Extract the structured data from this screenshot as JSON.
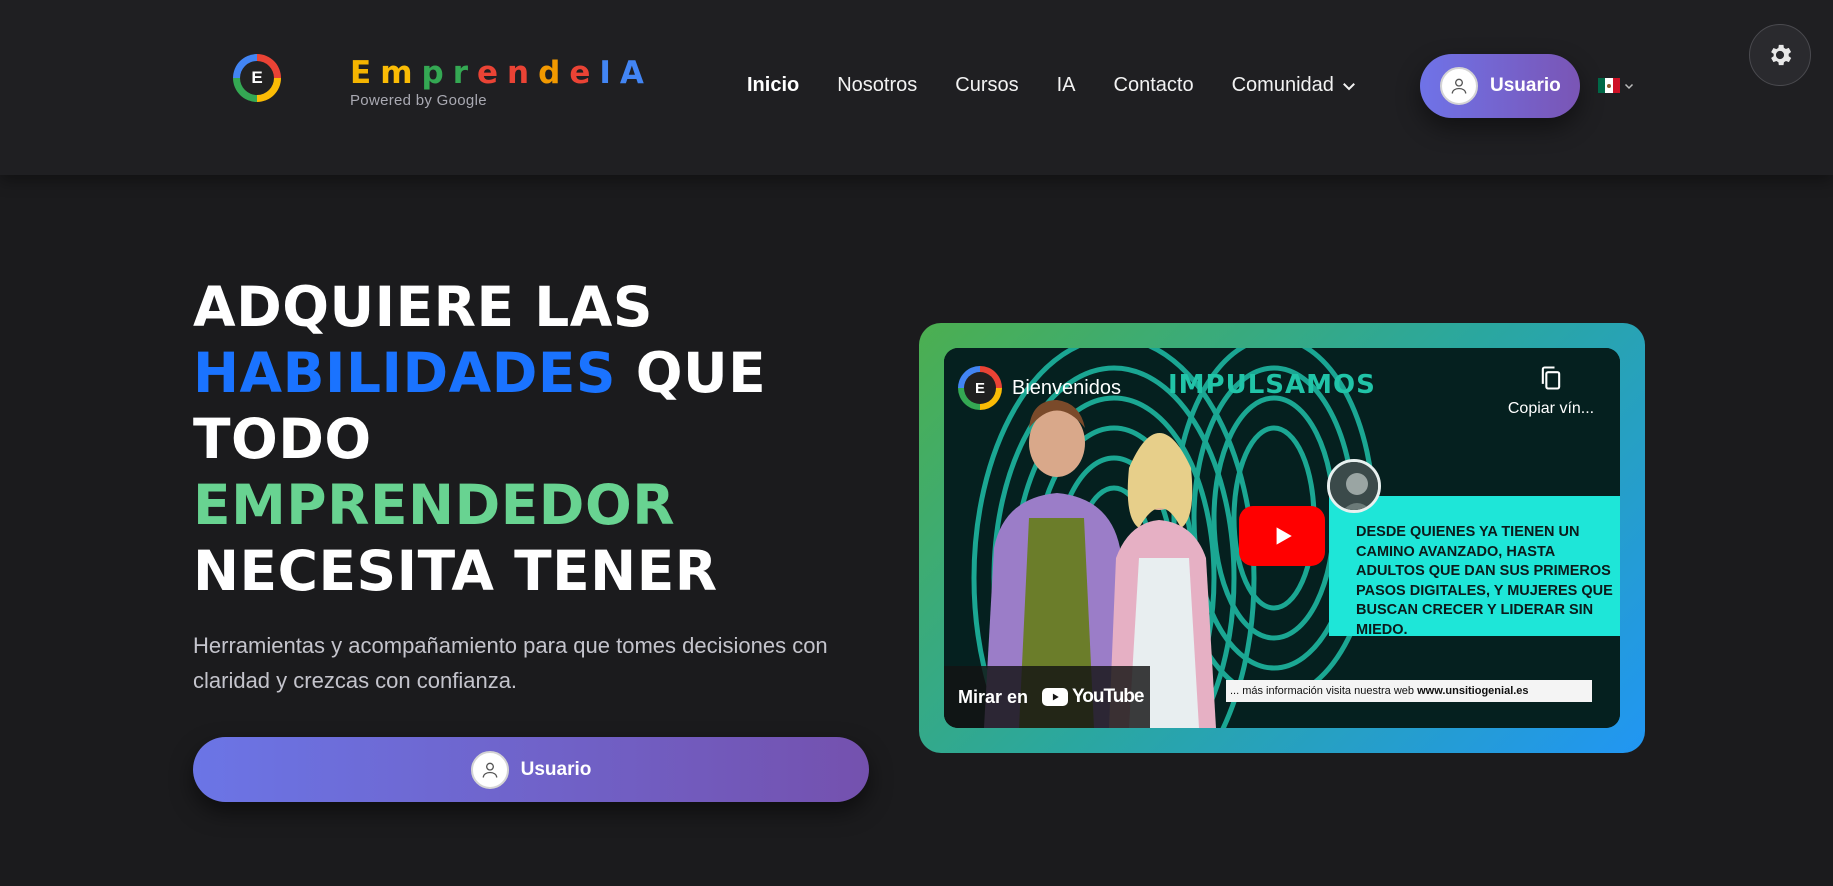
{
  "header": {
    "logo_letter": "E",
    "brand": {
      "name": "EmprendeIA",
      "letters": [
        {
          "ch": "E",
          "color": "#f4b400"
        },
        {
          "ch": "m",
          "color": "#fbbc05"
        },
        {
          "ch": "p",
          "color": "#34a853"
        },
        {
          "ch": "r",
          "color": "#34a853"
        },
        {
          "ch": "e",
          "color": "#ea4335"
        },
        {
          "ch": "n",
          "color": "#ea4335"
        },
        {
          "ch": "d",
          "color": "#f29900"
        },
        {
          "ch": "e",
          "color": "#ea4335"
        },
        {
          "ch": "I",
          "color": "#4285f4"
        },
        {
          "ch": "A",
          "color": "#4285f4"
        }
      ],
      "tagline": "Powered by Google"
    },
    "nav": [
      {
        "label": "Inicio",
        "active": true
      },
      {
        "label": "Nosotros",
        "active": false
      },
      {
        "label": "Cursos",
        "active": false
      },
      {
        "label": "IA",
        "active": false
      },
      {
        "label": "Contacto",
        "active": false
      },
      {
        "label": "Comunidad",
        "active": false,
        "dropdown": true
      }
    ],
    "user_button": "Usuario",
    "language": {
      "flag": "mexico-flag",
      "dropdown": true
    },
    "theme_toggle_icon": "gear-icon"
  },
  "hero": {
    "title_lines": [
      [
        {
          "text": "ADQUIERE LAS",
          "color": "white"
        }
      ],
      [
        {
          "text": "HABILIDADES",
          "color": "blue"
        },
        {
          "text": " QUE",
          "color": "white"
        }
      ],
      [
        {
          "text": "TODO",
          "color": "white"
        }
      ],
      [
        {
          "text": "EMPRENDEDOR",
          "color": "green"
        }
      ],
      [
        {
          "text": "NECESITA TENER",
          "color": "white"
        }
      ]
    ],
    "subtitle": "Herramientas y acompañamiento para que tomes decisiones con claridad y crezcas con confianza.",
    "cta_label": "Usuario"
  },
  "video": {
    "channel_logo_letter": "E",
    "title": "Bienvenidos",
    "headline": "IMPULSAMOS",
    "copy_link_label": "Copiar vín...",
    "panel_text": "DESDE QUIENES YA TIENEN UN CAMINO AVANZADO, HASTA ADULTOS QUE DAN SUS PRIMEROS PASOS DIGITALES, Y MUJERES QUE BUSCAN CRECER Y LIDERAR SIN MIEDO.",
    "watch_on_label": "Mirar en",
    "youtube_label": "YouTube",
    "ticker_text": "... más información visita nuestra web",
    "ticker_url": "www.unsitiogenial.es"
  },
  "colors": {
    "background": "#1b1b1d",
    "header_bg": "#1f1f22",
    "accent_blue": "#1a73ff",
    "accent_green": "#68d391",
    "button_gradient_start": "#6f73e8",
    "button_gradient_end": "#7a55b5"
  }
}
